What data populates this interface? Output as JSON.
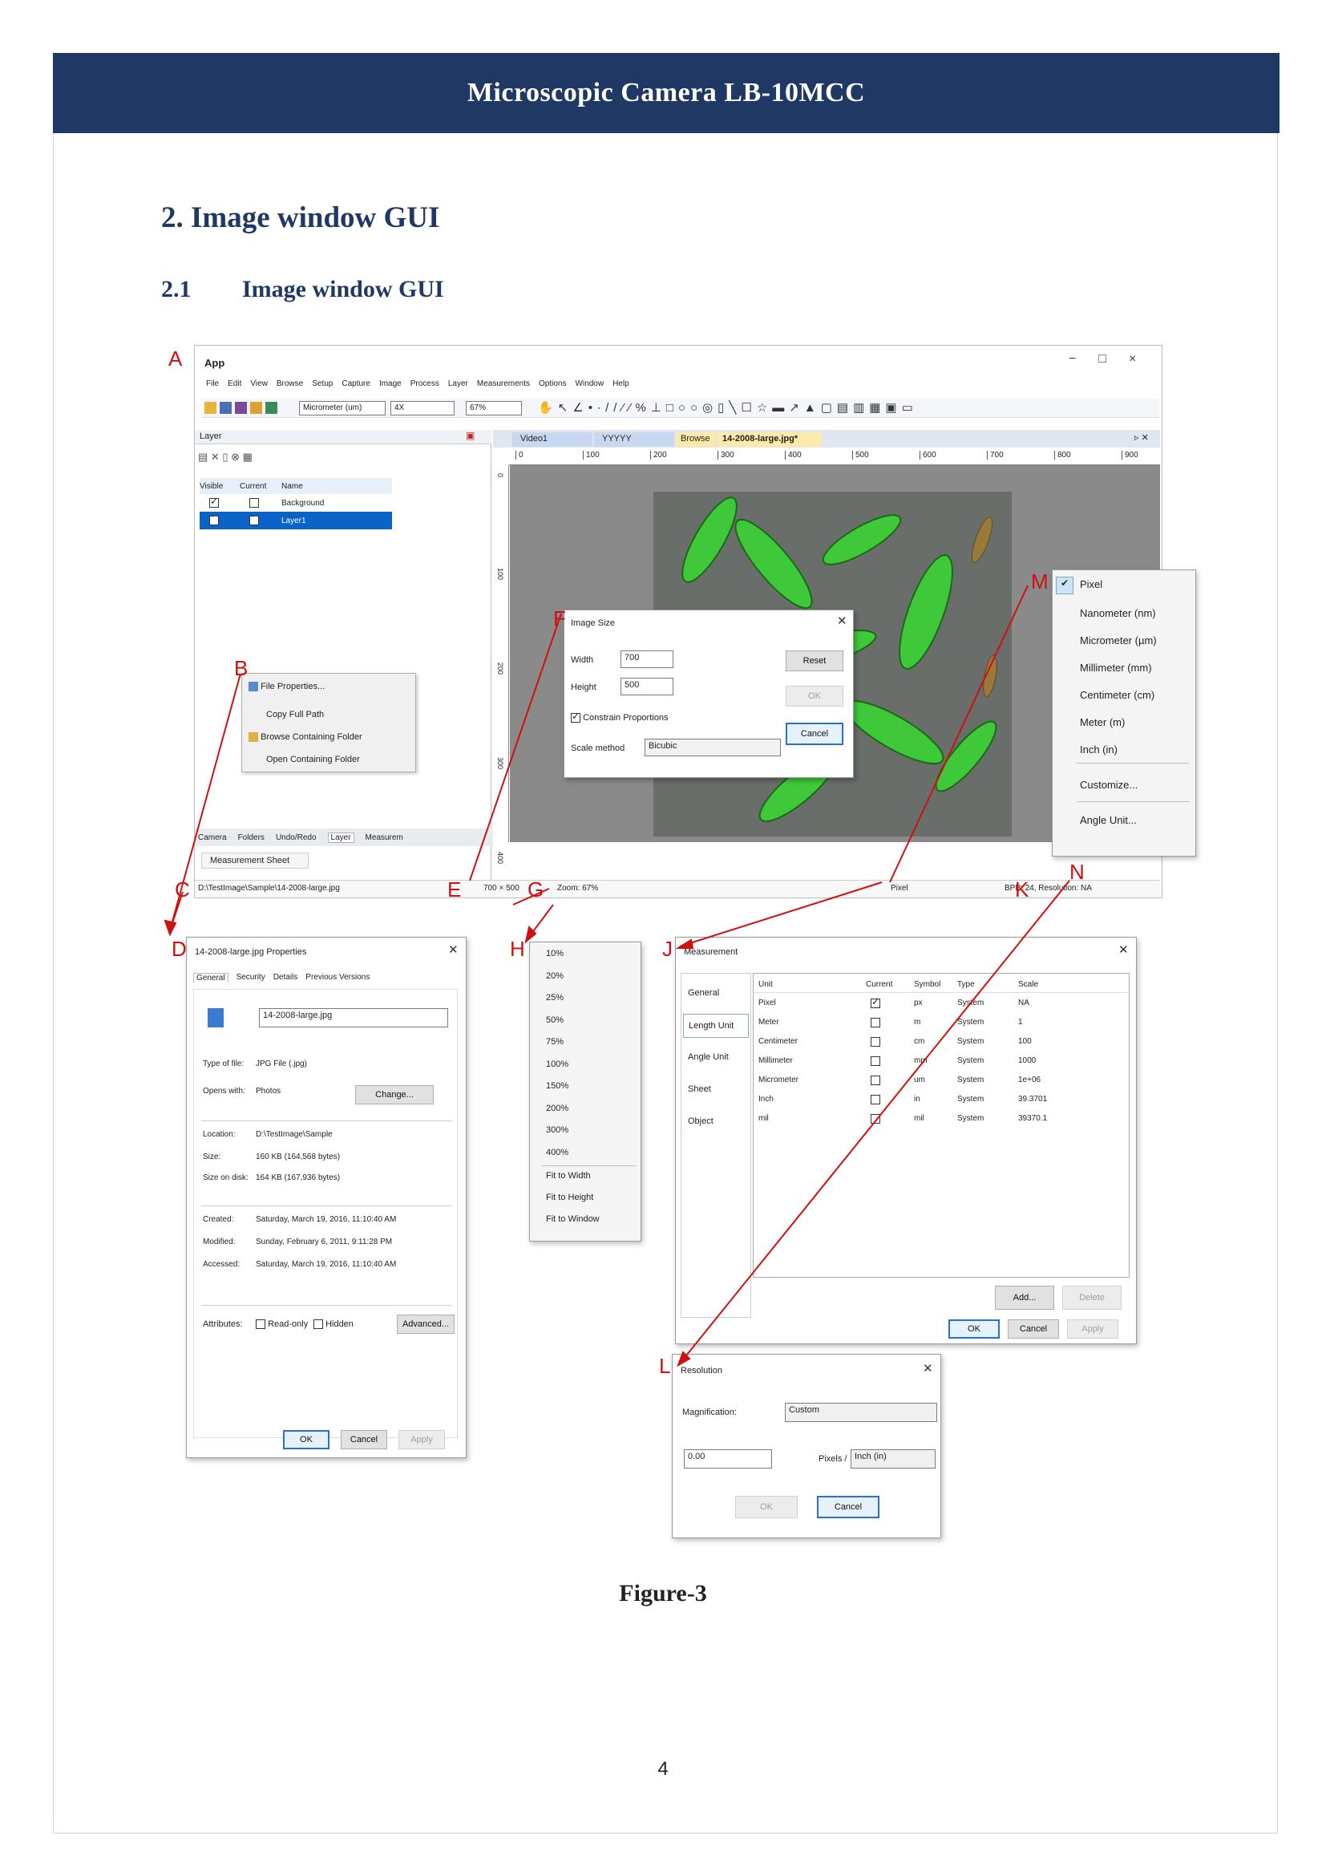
{
  "header": {
    "title": "Microscopic Camera LB-10MCC"
  },
  "section": {
    "title": "2.  Image window GUI",
    "sub_num": "2.1",
    "sub_title": "Image window GUI"
  },
  "caption": "Figure-3",
  "page_number": "4",
  "labels": {
    "A": "A",
    "B": "B",
    "C": "C",
    "D": "D",
    "E": "E",
    "F": "F",
    "G": "G",
    "H": "H",
    "J": "J",
    "K": "K",
    "L": "L",
    "M": "M",
    "N": "N"
  },
  "app": {
    "title": "App",
    "menu": [
      "File",
      "Edit",
      "View",
      "Browse",
      "Setup",
      "Capture",
      "Image",
      "Process",
      "Layer",
      "Measurements",
      "Options",
      "Window",
      "Help"
    ],
    "unit_select": "Micrometer (um)",
    "mag_select": "4X",
    "zoom_select": "67%",
    "layer_panel": {
      "title": "Layer",
      "columns": [
        "Visible",
        "Current",
        "Name"
      ],
      "rows": [
        {
          "name": "Background",
          "visible": true,
          "current": false
        },
        {
          "name": "Layer1",
          "visible": true,
          "current": true
        }
      ]
    },
    "tabs": [
      "Video1",
      "YYYYY",
      "Browse",
      "14-2008-large.jpg*"
    ],
    "ruler": [
      "0",
      "100",
      "200",
      "300",
      "400",
      "500",
      "600",
      "700",
      "800",
      "900"
    ],
    "vruler": [
      "0",
      "100",
      "200",
      "300",
      "400"
    ],
    "bottom_tabs": [
      "Camera",
      "Folders",
      "Undo/Redo",
      "Layer",
      "Measurem"
    ],
    "measurement_sheet_tab": "Measurement Sheet",
    "status": {
      "path": "D:\\TestImage\\Sample\\14-2008-large.jpg",
      "size": "700 × 500",
      "zoom": "Zoom: 67%",
      "unit": "Pixel",
      "bpp": "BPP: 24, Resolution: NA"
    }
  },
  "context_menu": {
    "items": [
      "File Properties...",
      "Copy Full Path",
      "Browse Containing Folder",
      "Open Containing Folder"
    ]
  },
  "image_size_dialog": {
    "title": "Image Size",
    "width_label": "Width",
    "width": "700",
    "height_label": "Height",
    "height": "500",
    "constrain": "Constrain Proportions",
    "scale_label": "Scale method",
    "scale": "Bicubic",
    "reset": "Reset",
    "ok": "OK",
    "cancel": "Cancel"
  },
  "unit_menu": {
    "items": [
      "Pixel",
      "Nanometer (nm)",
      "Micrometer (µm)",
      "Millimeter (mm)",
      "Centimeter (cm)",
      "Meter (m)",
      "Inch (in)",
      "Customize...",
      "Angle Unit..."
    ]
  },
  "properties_dialog": {
    "title": "14-2008-large.jpg Properties",
    "tabs": [
      "General",
      "Security",
      "Details",
      "Previous Versions"
    ],
    "filename": "14-2008-large.jpg",
    "rows": [
      [
        "Type of file:",
        "JPG File (.jpg)"
      ],
      [
        "Opens with:",
        "Photos"
      ],
      [
        "Location:",
        "D:\\TestImage\\Sample"
      ],
      [
        "Size:",
        "160 KB (164,568 bytes)"
      ],
      [
        "Size on disk:",
        "164 KB (167,936 bytes)"
      ],
      [
        "Created:",
        "Saturday, March 19, 2016, 11:10:40 AM"
      ],
      [
        "Modified:",
        "Sunday, February 6, 2011, 9:11:28 PM"
      ],
      [
        "Accessed:",
        "Saturday, March 19, 2016, 11:10:40 AM"
      ]
    ],
    "change": "Change...",
    "attributes": "Attributes:",
    "readonly": "Read-only",
    "hidden": "Hidden",
    "advanced": "Advanced...",
    "ok": "OK",
    "cancel": "Cancel",
    "apply": "Apply"
  },
  "zoom_menu": {
    "items": [
      "10%",
      "20%",
      "25%",
      "50%",
      "75%",
      "100%",
      "150%",
      "200%",
      "300%",
      "400%",
      "Fit to Width",
      "Fit to Height",
      "Fit to Window"
    ]
  },
  "measurement_dialog": {
    "title": "Measurement",
    "side": [
      "General",
      "Length Unit",
      "Angle Unit",
      "Sheet",
      "Object"
    ],
    "columns": [
      "Unit",
      "Current",
      "Symbol",
      "Type",
      "Scale"
    ],
    "rows": [
      [
        "Pixel",
        "true",
        "px",
        "System",
        "NA"
      ],
      [
        "Meter",
        "false",
        "m",
        "System",
        "1"
      ],
      [
        "Centimeter",
        "false",
        "cm",
        "System",
        "100"
      ],
      [
        "Millimeter",
        "false",
        "mm",
        "System",
        "1000"
      ],
      [
        "Micrometer",
        "false",
        "um",
        "System",
        "1e+06"
      ],
      [
        "Inch",
        "false",
        "in",
        "System",
        "39.3701"
      ],
      [
        "mil",
        "false",
        "mil",
        "System",
        "39370.1"
      ]
    ],
    "add": "Add...",
    "delete": "Delete",
    "ok": "OK",
    "cancel": "Cancel",
    "apply": "Apply"
  },
  "resolution_dialog": {
    "title": "Resolution",
    "mag_label": "Magnification:",
    "mag": "Custom",
    "value": "0.00",
    "pixels_label": "Pixels /",
    "unit": "Inch (in)",
    "ok": "OK",
    "cancel": "Cancel"
  }
}
